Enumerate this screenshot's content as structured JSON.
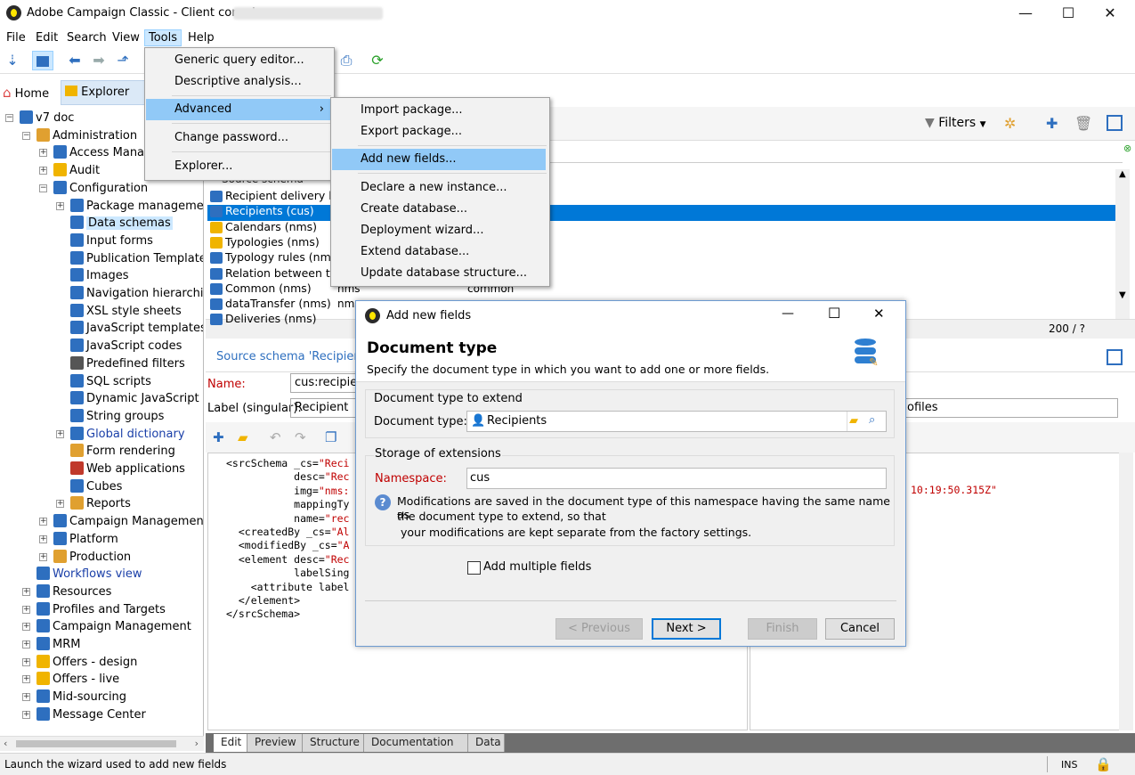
{
  "window": {
    "title": "Adobe Campaign Classic - Client console",
    "minimize": "—",
    "maximize": "☐",
    "close": "✕"
  },
  "menubar": [
    "File",
    "Edit",
    "Search",
    "View",
    "Tools",
    "Help"
  ],
  "tabs": {
    "home": "Home",
    "explorer": "Explorer"
  },
  "tree": [
    {
      "label": "v7 doc",
      "level": 0,
      "exp": "−",
      "color": "#2e6fbf"
    },
    {
      "label": "Administration",
      "level": 1,
      "exp": "−",
      "color": "#e0a030"
    },
    {
      "label": "Access Manag",
      "level": 2,
      "exp": "+",
      "color": "#2e6fbf"
    },
    {
      "label": "Audit",
      "level": 2,
      "exp": "+",
      "color": "#f0b400"
    },
    {
      "label": "Configuration",
      "level": 2,
      "exp": "−",
      "color": "#2e6fbf"
    },
    {
      "label": "Package management",
      "level": 3,
      "exp": "+",
      "color": "#2e6fbf"
    },
    {
      "label": "Data schemas",
      "level": 3,
      "exp": "",
      "color": "#2e6fbf",
      "selected": true
    },
    {
      "label": "Input forms",
      "level": 3,
      "exp": "",
      "color": "#2e6fbf"
    },
    {
      "label": "Publication Templates",
      "level": 3,
      "exp": "",
      "color": "#2e6fbf"
    },
    {
      "label": "Images",
      "level": 3,
      "exp": "",
      "color": "#2e6fbf"
    },
    {
      "label": "Navigation hierarchies",
      "level": 3,
      "exp": "",
      "color": "#2e6fbf"
    },
    {
      "label": "XSL style sheets",
      "level": 3,
      "exp": "",
      "color": "#2e6fbf"
    },
    {
      "label": "JavaScript templates",
      "level": 3,
      "exp": "",
      "color": "#2e6fbf"
    },
    {
      "label": "JavaScript codes",
      "level": 3,
      "exp": "",
      "color": "#2e6fbf"
    },
    {
      "label": "Predefined filters",
      "level": 3,
      "exp": "",
      "color": "#555555"
    },
    {
      "label": "SQL scripts",
      "level": 3,
      "exp": "",
      "color": "#2e6fbf"
    },
    {
      "label": "Dynamic JavaScript pag",
      "level": 3,
      "exp": "",
      "color": "#2e6fbf"
    },
    {
      "label": "String groups",
      "level": 3,
      "exp": "",
      "color": "#2e6fbf"
    },
    {
      "label": "Global dictionary",
      "level": 3,
      "exp": "+",
      "color": "#2e6fbf",
      "link": true
    },
    {
      "label": "Form rendering",
      "level": 3,
      "exp": "",
      "color": "#e0a030"
    },
    {
      "label": "Web applications",
      "level": 3,
      "exp": "",
      "color": "#c0392b"
    },
    {
      "label": "Cubes",
      "level": 3,
      "exp": "",
      "color": "#2e6fbf"
    },
    {
      "label": "Reports",
      "level": 3,
      "exp": "+",
      "color": "#e0a030"
    },
    {
      "label": "Campaign Management",
      "level": 2,
      "exp": "+",
      "color": "#2e6fbf"
    },
    {
      "label": "Platform",
      "level": 2,
      "exp": "+",
      "color": "#2e6fbf"
    },
    {
      "label": "Production",
      "level": 2,
      "exp": "+",
      "color": "#e0a030"
    },
    {
      "label": "Workflows view",
      "level": 1,
      "exp": "",
      "color": "#2e6fbf",
      "link": true
    },
    {
      "label": "Resources",
      "level": 1,
      "exp": "+",
      "color": "#2e6fbf"
    },
    {
      "label": "Profiles and Targets",
      "level": 1,
      "exp": "+",
      "color": "#2e6fbf"
    },
    {
      "label": "Campaign Management",
      "level": 1,
      "exp": "+",
      "color": "#2e6fbf"
    },
    {
      "label": "MRM",
      "level": 1,
      "exp": "+",
      "color": "#2e6fbf"
    },
    {
      "label": "Offers - design",
      "level": 1,
      "exp": "+",
      "color": "#f0b400"
    },
    {
      "label": "Offers - live",
      "level": 1,
      "exp": "+",
      "color": "#f0b400"
    },
    {
      "label": "Mid-sourcing",
      "level": 1,
      "exp": "+",
      "color": "#2e6fbf"
    },
    {
      "label": "Message Center",
      "level": 1,
      "exp": "+",
      "color": "#2e6fbf"
    }
  ],
  "list": {
    "filters": "Filters",
    "header": "Source schema",
    "rows": [
      "Recipient delivery l...",
      "Recipients (cus)",
      "Calendars (nms)",
      "Typologies (nms)",
      "Typology rules (nms",
      "Relation between typ",
      "Common (nms)",
      "dataTransfer (nms)",
      "Deliveries (nms)"
    ],
    "row6_col2": "nms",
    "row6_col3": "common",
    "row7_col2": "nms",
    "count": "200 / ?"
  },
  "detail": {
    "title": "Source schema 'Recipier",
    "name_label": "Name:",
    "name_value": "cus:recipient",
    "label_label": "Label (singular):",
    "label_value": "Recipient",
    "right_value": "ofiles",
    "timestamp": "10:19:50.315Z\""
  },
  "code": [
    "<srcSchema _cs=\"Reci",
    "           desc=\"Rec",
    "           img=\"nms:",
    "           mappingTy",
    "           name=\"rec",
    "  <createdBy _cs=\"Al",
    "  <modifiedBy _cs=\"A",
    "  <element desc=\"Rec",
    "           labelSing",
    "    <attribute label",
    "  </element>",
    "</srcSchema>"
  ],
  "bottom_tabs": [
    "Edit",
    "Preview",
    "Structure",
    "Documentation",
    "Data"
  ],
  "tools_menu": [
    "Generic query editor...",
    "Descriptive analysis...",
    "Advanced",
    "Change password...",
    "Explorer..."
  ],
  "advanced_menu": [
    "Import package...",
    "Export package...",
    "Add new fields...",
    "Declare a new instance...",
    "Create database...",
    "Deployment wizard...",
    "Extend database...",
    "Update database structure..."
  ],
  "dialog": {
    "title": "Add new fields",
    "heading": "Document type",
    "subheading": "Specify the document type in which you want to add one or more fields.",
    "group1": "Document type to extend",
    "doctype_label": "Document type:",
    "doctype_value": "Recipients",
    "group2": "Storage of extensions",
    "namespace_label": "Namespace:",
    "namespace_value": "cus",
    "info_line1": "Modifications are saved in the document type of this namespace having the same name as",
    "info_line2": "the document type to extend, so that",
    "info_line3": " your modifications are kept separate from the factory settings.",
    "checkbox": "Add multiple fields",
    "btn_previous": "< Previous",
    "btn_next": "Next >",
    "btn_finish": "Finish",
    "btn_cancel": "Cancel"
  },
  "status": {
    "text": "Launch the wizard used to add new fields",
    "ins": "INS"
  }
}
